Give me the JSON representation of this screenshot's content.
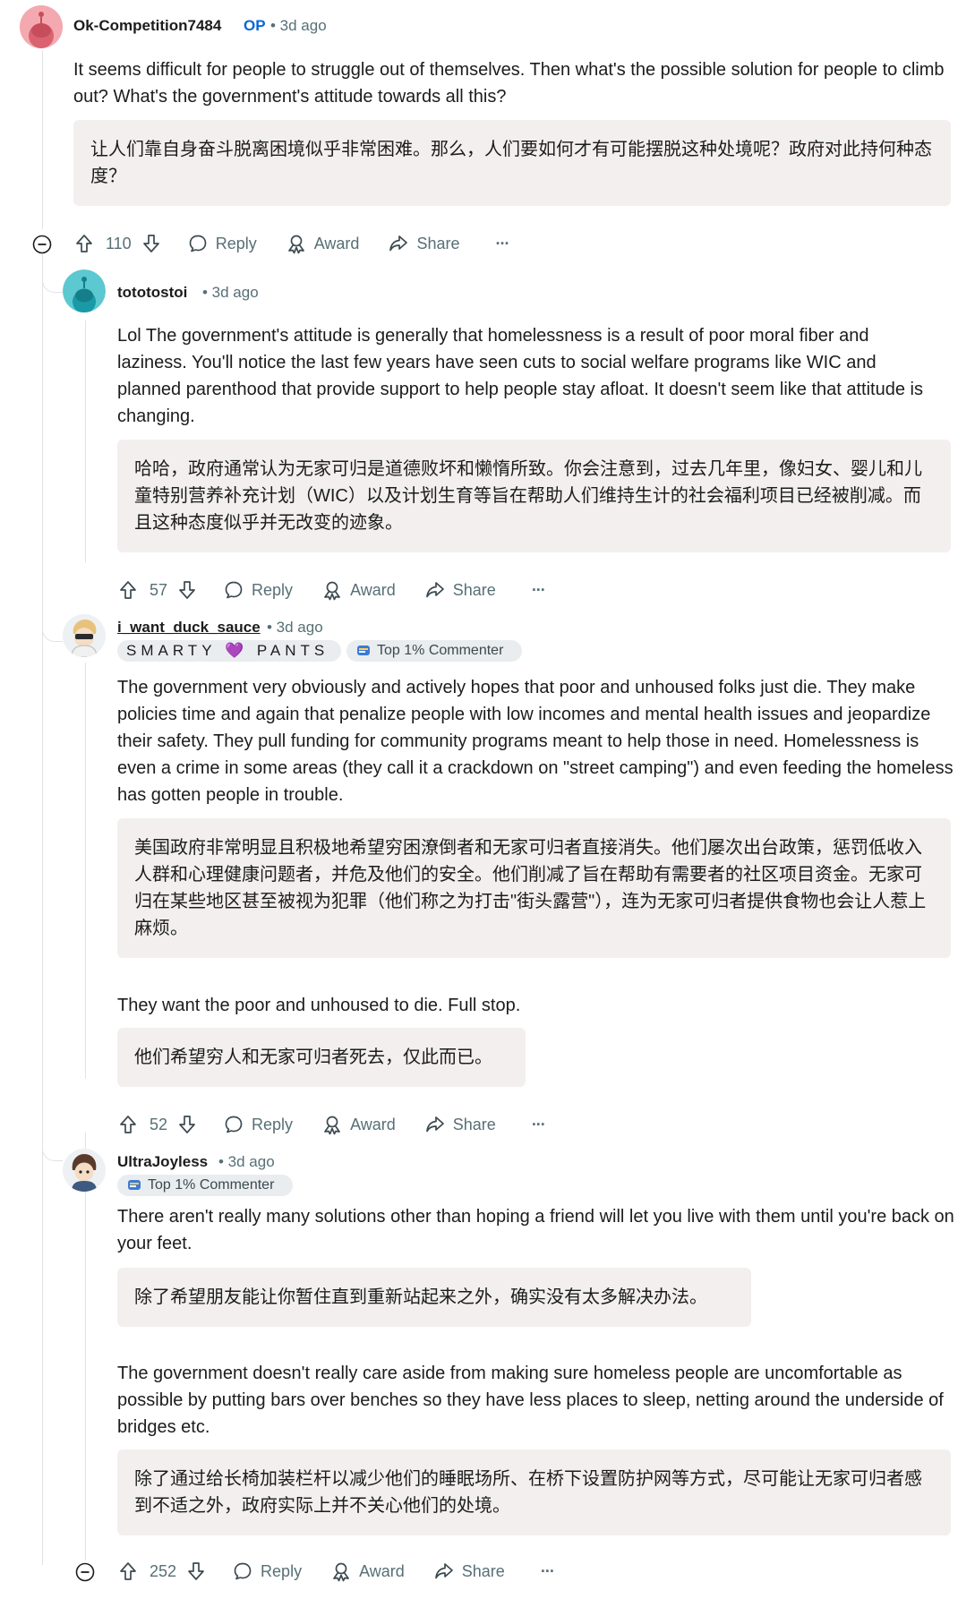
{
  "comments": [
    {
      "username": "Ok-Competition7484",
      "op_label": "OP",
      "time": "• 3d ago",
      "body": [
        "It seems difficult for people to struggle out of themselves. Then what's the possible solution for people to climb out? What's the government's attitude towards all this?"
      ],
      "translations": [
        "让人们靠自身奋斗脱离困境似乎非常困难。那么，人们要如何才有可能摆脱这种处境呢？政府对此持何种态度？"
      ],
      "votes": "110",
      "reply_label": "Reply",
      "award_label": "Award",
      "share_label": "Share",
      "more_label": "···"
    },
    {
      "username": "tototostoi",
      "time": "• 3d ago",
      "body": [
        "Lol The government's attitude is generally that homelessness is a result of poor moral fiber and laziness. You'll notice the last few years have seen cuts to social welfare programs like WIC and planned parenthood that provide support to help people stay afloat. It doesn't seem like that attitude is changing."
      ],
      "translations": [
        "哈哈，政府通常认为无家可归是道德败坏和懒惰所致。你会注意到，过去几年里，像妇女、婴儿和儿童特别营养补充计划（WIC）以及计划生育等旨在帮助人们维持生计的社会福利项目已经被削减。而且这种态度似乎并无改变的迹象。"
      ],
      "votes": "57",
      "reply_label": "Reply",
      "award_label": "Award",
      "share_label": "Share",
      "more_label": "···"
    },
    {
      "username": "i_want_duck_sauce",
      "time": "• 3d ago",
      "flair_text": "SMARTY 💜 PANTS",
      "badge": "Top 1% Commenter",
      "body": [
        "The government very obviously and actively hopes that poor and unhoused folks just die. They make policies time and again that penalize people with low incomes and mental health issues and jeopardize their safety. They pull funding for community programs meant to help those in need. Homelessness is even a crime in some areas (they call it a crackdown on \"street camping\") and even feeding the homeless has gotten people in trouble.",
        "They want the poor and unhoused to die. Full stop."
      ],
      "translations": [
        "美国政府非常明显且积极地希望穷困潦倒者和无家可归者直接消失。他们屡次出台政策，惩罚低收入人群和心理健康问题者，并危及他们的安全。他们削减了旨在帮助有需要者的社区项目资金。无家可归在某些地区甚至被视为犯罪（他们称之为打击\"街头露营\"），连为无家可归者提供食物也会让人惹上麻烦。",
        "他们希望穷人和无家可归者死去，仅此而已。"
      ],
      "votes": "52",
      "reply_label": "Reply",
      "award_label": "Award",
      "share_label": "Share",
      "more_label": "···"
    },
    {
      "username": "UltraJoyless",
      "time": "• 3d ago",
      "badge": "Top 1% Commenter",
      "body": [
        "There aren't really many solutions other than hoping a friend will let you live with them until you're back on your feet.",
        "The government doesn't really care aside from making sure homeless people are uncomfortable as possible by putting bars over benches so they have less places to sleep, netting around the underside of bridges etc."
      ],
      "translations": [
        "除了希望朋友能让你暂住直到重新站起来之外，确实没有太多解决办法。",
        "除了通过给长椅加装栏杆以减少他们的睡眠场所、在桥下设置防护网等方式，尽可能让无家可归者感到不适之外，政府实际上并不关心他们的处境。"
      ],
      "votes": "252",
      "reply_label": "Reply",
      "award_label": "Award",
      "share_label": "Share",
      "more_label": "···"
    }
  ],
  "icons": [
    "avatar",
    "collapse-icon",
    "upvote-icon",
    "downvote-icon",
    "reply-icon",
    "award-icon",
    "share-icon",
    "more-icon",
    "trophy-icon"
  ],
  "colors": {
    "op": "#0a66d8",
    "meta": "#576f76",
    "translation_bg": "#f3efef",
    "flair_bg": "#eaedef"
  }
}
